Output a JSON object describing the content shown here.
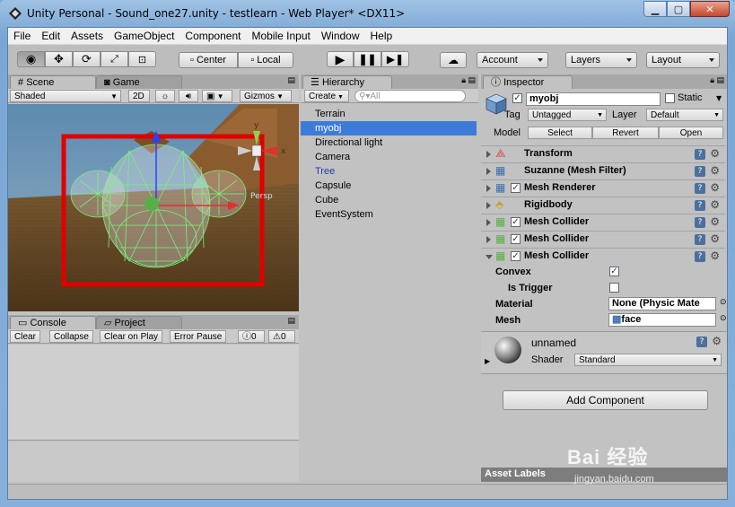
{
  "window": {
    "title": "Unity Personal - Sound_one27.unity - testlearn - Web Player* <DX11>"
  },
  "menu": [
    "File",
    "Edit",
    "Assets",
    "GameObject",
    "Component",
    "Mobile Input",
    "Window",
    "Help"
  ],
  "toolbar": {
    "pivot": "Center",
    "space": "Local",
    "account": "Account",
    "layers": "Layers",
    "layout": "Layout"
  },
  "scene": {
    "tabs": [
      "Scene",
      "Game"
    ],
    "shading": "Shaded",
    "mode2d": "2D",
    "gizmos": "Gizmos",
    "persp": "Persp",
    "axis_x": "x",
    "axis_y": "y"
  },
  "console": {
    "tabs": [
      "Console",
      "Project"
    ],
    "buttons": [
      "Clear",
      "Collapse",
      "Clear on Play",
      "Error Pause"
    ],
    "counts": [
      "0",
      "0"
    ]
  },
  "hierarchy": {
    "tab": "Hierarchy",
    "create": "Create",
    "search_placeholder": "All",
    "items": [
      {
        "label": "Terrain",
        "selected": false,
        "prefab": false
      },
      {
        "label": "myobj",
        "selected": true,
        "prefab": false
      },
      {
        "label": "Directional light",
        "selected": false,
        "prefab": false
      },
      {
        "label": "Camera",
        "selected": false,
        "prefab": false
      },
      {
        "label": "Tree",
        "selected": false,
        "prefab": true
      },
      {
        "label": "Capsule",
        "selected": false,
        "prefab": false
      },
      {
        "label": "Cube",
        "selected": false,
        "prefab": false
      },
      {
        "label": "EventSystem",
        "selected": false,
        "prefab": false
      }
    ]
  },
  "inspector": {
    "tab": "Inspector",
    "name": "myobj",
    "static_label": "Static",
    "tag_label": "Tag",
    "tag": "Untagged",
    "layer_label": "Layer",
    "layer": "Default",
    "model_label": "Model",
    "model_buttons": [
      "Select",
      "Revert",
      "Open"
    ],
    "components": [
      {
        "label": "Transform",
        "checkbox": false,
        "icon": "transform-icon"
      },
      {
        "label": "Suzanne (Mesh Filter)",
        "checkbox": false,
        "icon": "mesh-filter-icon"
      },
      {
        "label": "Mesh Renderer",
        "checkbox": true,
        "icon": "mesh-renderer-icon"
      },
      {
        "label": "Rigidbody",
        "checkbox": false,
        "icon": "rigidbody-icon"
      },
      {
        "label": "Mesh Collider",
        "checkbox": true,
        "icon": "mesh-collider-icon"
      },
      {
        "label": "Mesh Collider",
        "checkbox": true,
        "icon": "mesh-collider-icon"
      },
      {
        "label": "Mesh Collider",
        "checkbox": true,
        "icon": "mesh-collider-icon"
      }
    ],
    "collider_props": {
      "convex_label": "Convex",
      "trigger_label": "Is Trigger",
      "material_label": "Material",
      "material_value": "None (Physic Mate",
      "mesh_label": "Mesh",
      "mesh_value": "face"
    },
    "material": {
      "name": "unnamed",
      "shader_label": "Shader",
      "shader": "Standard"
    },
    "add_component": "Add Component",
    "asset_labels": "Asset Labels"
  },
  "watermark": {
    "text": "Bai 经验",
    "url": "jingyan.baidu.com"
  },
  "colors": {
    "selection": "#3d7bd8",
    "highlight_box": "#e00000",
    "wireframe": "#7cf07c"
  }
}
